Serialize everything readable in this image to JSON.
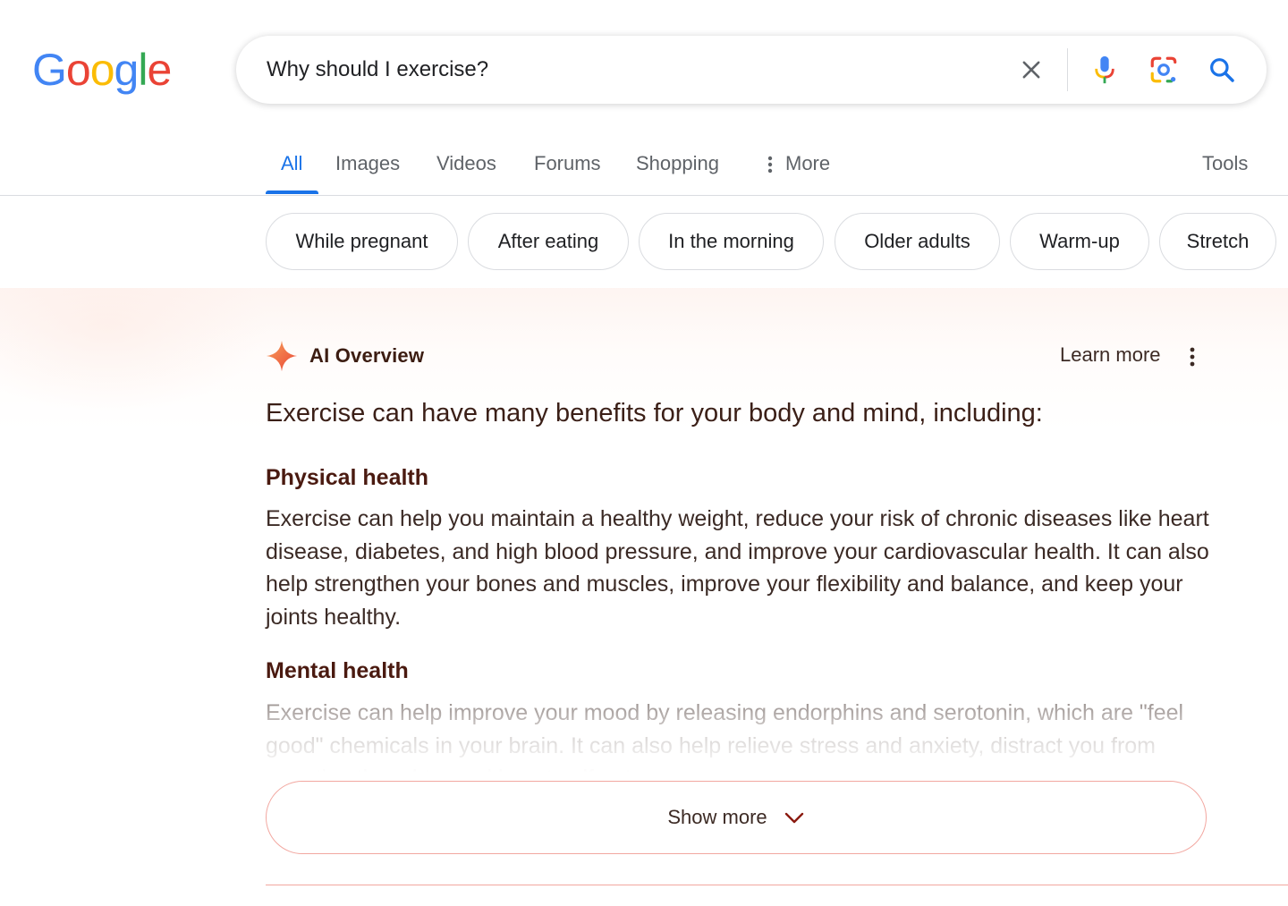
{
  "logo": {
    "letters": [
      "G",
      "o",
      "o",
      "g",
      "l",
      "e"
    ],
    "colors": [
      "#4285F4",
      "#EA4335",
      "#FBBC05",
      "#4285F4",
      "#34A853",
      "#EA4335"
    ]
  },
  "search": {
    "value": "Why should I exercise?",
    "icons": [
      "close-icon",
      "mic-icon",
      "lens-icon",
      "search-icon"
    ]
  },
  "tabs": [
    {
      "label": "All",
      "active": true
    },
    {
      "label": "Images"
    },
    {
      "label": "Videos"
    },
    {
      "label": "Forums"
    },
    {
      "label": "Shopping"
    },
    {
      "label": "More"
    }
  ],
  "tools_label": "Tools",
  "chips": [
    "While pregnant",
    "After eating",
    "In the morning",
    "Older adults",
    "Warm-up",
    "Stretch"
  ],
  "ai_overview": {
    "title": "AI Overview",
    "learn_more": "Learn more",
    "lead": "Exercise can have many benefits for your body and mind, including:",
    "sections": [
      {
        "heading": "Physical health",
        "body": "Exercise can help you maintain a healthy weight, reduce your risk of chronic diseases like heart disease, diabetes, and high blood pressure, and improve your cardiovascular health. It can also help strengthen your bones and muscles, improve your flexibility and balance, and keep your joints healthy."
      },
      {
        "heading": "Mental health",
        "body": "Exercise can help improve your mood by releasing endorphins and serotonin, which are \"feel good\" chemicals in your brain. It can also help relieve stress and anxiety, distract you from negative thoughts, and boost self-esteem."
      }
    ],
    "show_more": "Show more"
  },
  "colors": {
    "accent": "#1a73e8",
    "ai_heading": "#4a1a10",
    "show_more_border": "#f2a7a0"
  }
}
